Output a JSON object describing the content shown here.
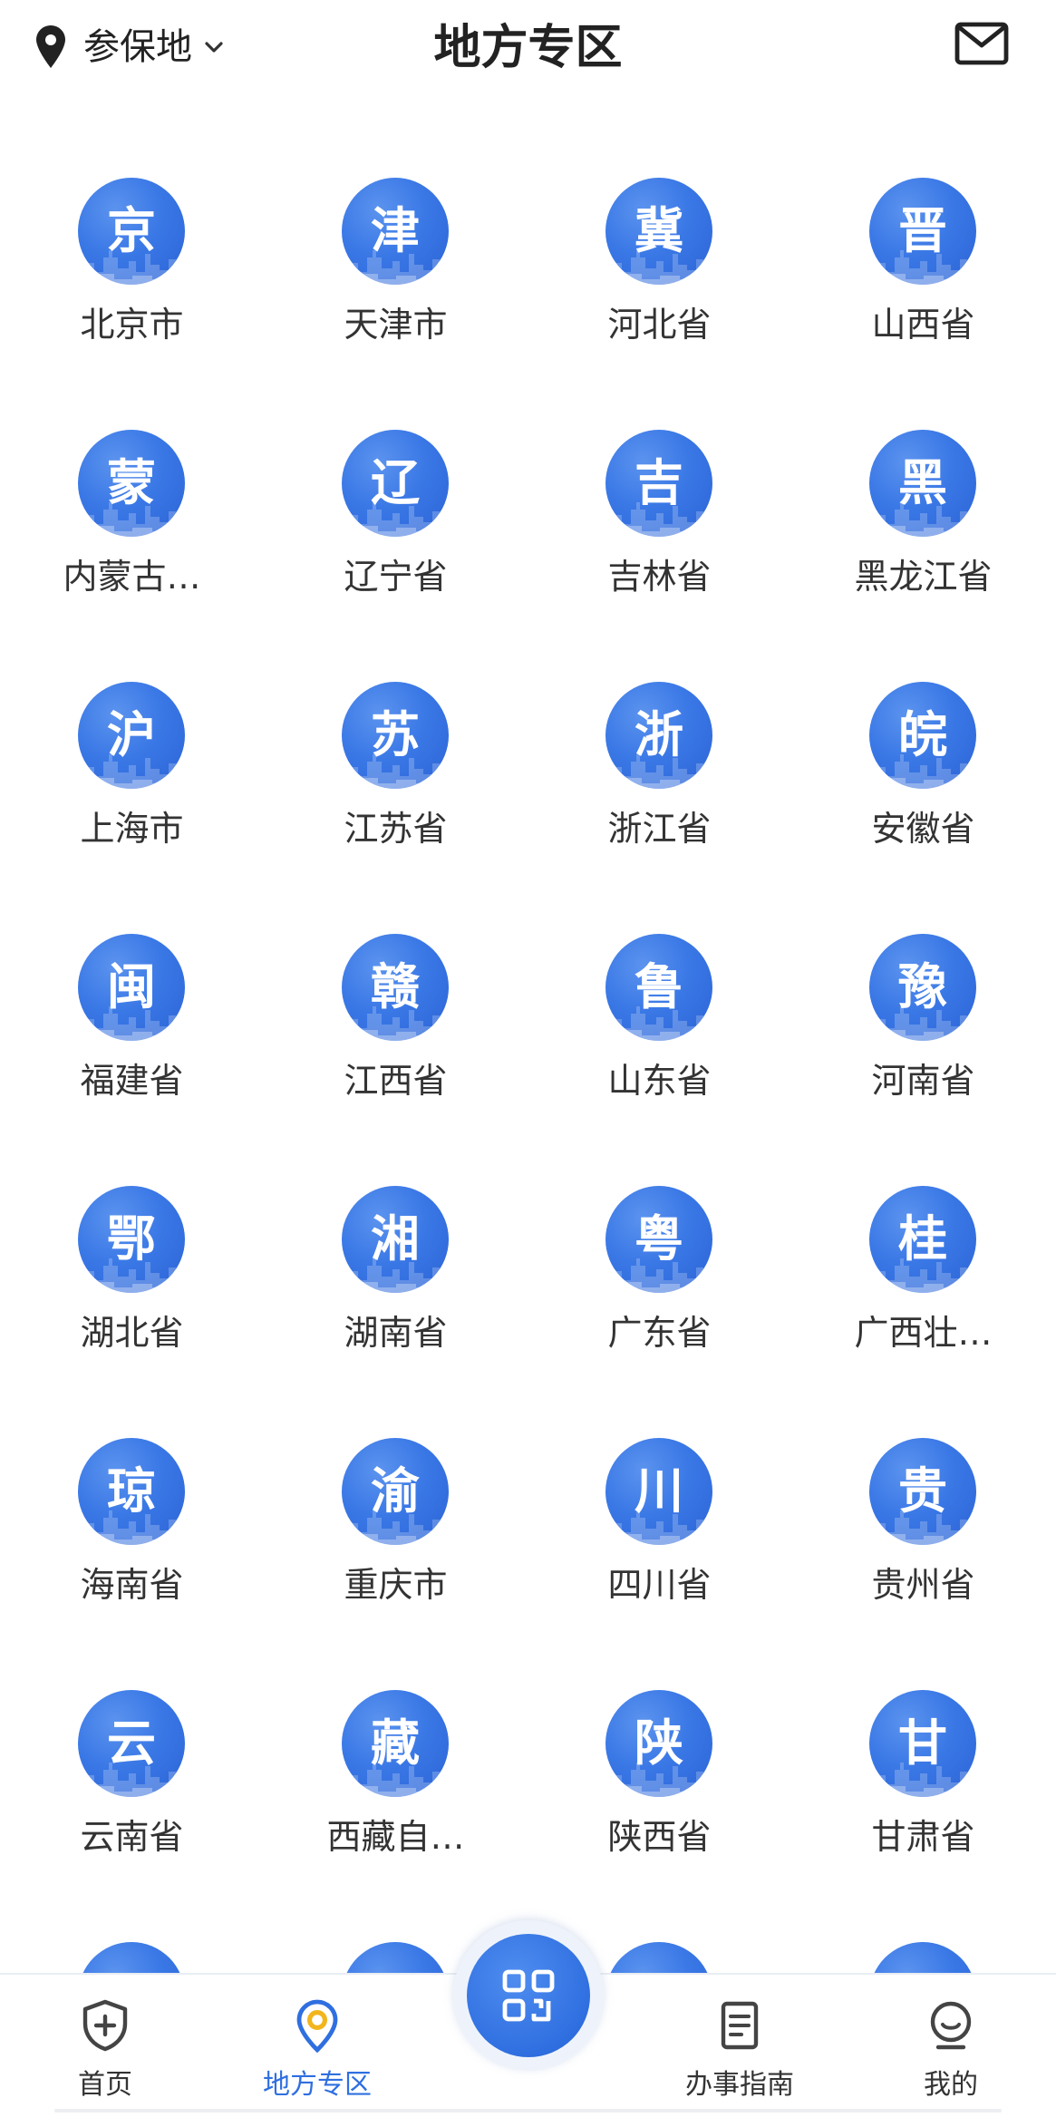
{
  "header": {
    "location_label": "参保地",
    "title": "地方专区"
  },
  "regions": [
    {
      "glyph": "京",
      "name": "北京市"
    },
    {
      "glyph": "津",
      "name": "天津市"
    },
    {
      "glyph": "冀",
      "name": "河北省"
    },
    {
      "glyph": "晋",
      "name": "山西省"
    },
    {
      "glyph": "蒙",
      "name": "内蒙古…"
    },
    {
      "glyph": "辽",
      "name": "辽宁省"
    },
    {
      "glyph": "吉",
      "name": "吉林省"
    },
    {
      "glyph": "黑",
      "name": "黑龙江省"
    },
    {
      "glyph": "沪",
      "name": "上海市"
    },
    {
      "glyph": "苏",
      "name": "江苏省"
    },
    {
      "glyph": "浙",
      "name": "浙江省"
    },
    {
      "glyph": "皖",
      "name": "安徽省"
    },
    {
      "glyph": "闽",
      "name": "福建省"
    },
    {
      "glyph": "赣",
      "name": "江西省"
    },
    {
      "glyph": "鲁",
      "name": "山东省"
    },
    {
      "glyph": "豫",
      "name": "河南省"
    },
    {
      "glyph": "鄂",
      "name": "湖北省"
    },
    {
      "glyph": "湘",
      "name": "湖南省"
    },
    {
      "glyph": "粤",
      "name": "广东省"
    },
    {
      "glyph": "桂",
      "name": "广西壮…"
    },
    {
      "glyph": "琼",
      "name": "海南省"
    },
    {
      "glyph": "渝",
      "name": "重庆市"
    },
    {
      "glyph": "川",
      "name": "四川省"
    },
    {
      "glyph": "贵",
      "name": "贵州省"
    },
    {
      "glyph": "云",
      "name": "云南省"
    },
    {
      "glyph": "藏",
      "name": "西藏自…"
    },
    {
      "glyph": "陕",
      "name": "陕西省"
    },
    {
      "glyph": "甘",
      "name": "甘肃省"
    }
  ],
  "nav": {
    "home": "首页",
    "regional": "地方专区",
    "guide": "办事指南",
    "mine": "我的"
  },
  "colors": {
    "accent": "#2f6fe0",
    "badge_blue": "#3a78e6"
  }
}
